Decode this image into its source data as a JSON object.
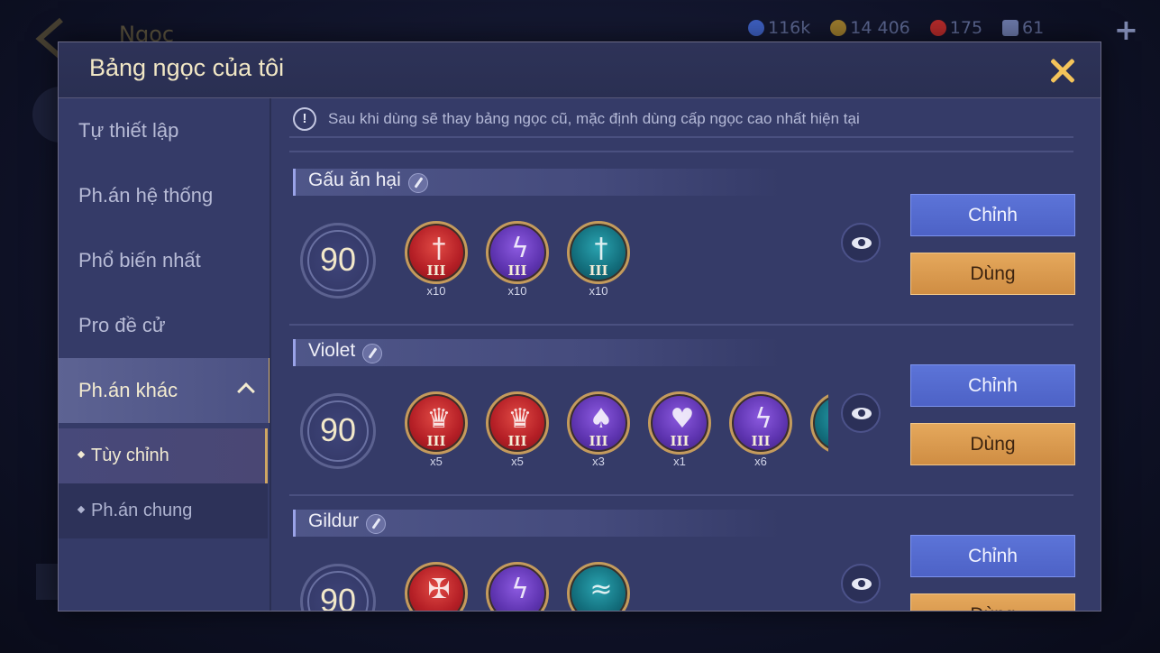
{
  "background": {
    "title": "Ngọc",
    "currencies": [
      {
        "icon": "diamond-coin-icon",
        "value": "116k",
        "color": "#3d5fc0"
      },
      {
        "icon": "gold-coin-icon",
        "value": "14 406",
        "color": "#9a7a2d"
      },
      {
        "icon": "ruby-icon",
        "value": "175",
        "color": "#b32a2a"
      },
      {
        "icon": "voucher-icon",
        "value": "61",
        "color": "#6b78a8"
      }
    ]
  },
  "modal": {
    "title": "Bảng ngọc của tôi",
    "notice": "Sau khi dùng sẽ thay bảng ngọc cũ, mặc định dùng cấp ngọc cao nhất hiện tại"
  },
  "sidebar": {
    "items": [
      {
        "label": "Tự thiết lập"
      },
      {
        "label": "Ph.án hệ thống"
      },
      {
        "label": "Phổ biến nhất"
      },
      {
        "label": "Pro đề cử"
      },
      {
        "label": "Ph.án khác"
      }
    ],
    "subitems": [
      {
        "label": "Tùy chỉnh"
      },
      {
        "label": "Ph.án chung"
      }
    ]
  },
  "sets": [
    {
      "name": "Gấu ăn hại",
      "level": "90",
      "arcanas": [
        {
          "color": "red",
          "icon": "sword-icon",
          "tier": "III",
          "count": "x10"
        },
        {
          "color": "purple",
          "icon": "lightning-icon",
          "tier": "III",
          "count": "x10"
        },
        {
          "color": "teal",
          "icon": "sword-icon",
          "tier": "III",
          "count": "x10"
        }
      ],
      "edit_label": "Chỉnh",
      "use_label": "Dùng"
    },
    {
      "name": "Violet",
      "level": "90",
      "arcanas": [
        {
          "color": "red",
          "icon": "crown-icon",
          "tier": "III",
          "count": "x5"
        },
        {
          "color": "red",
          "icon": "crown-icon",
          "tier": "III",
          "count": "x5"
        },
        {
          "color": "purple",
          "icon": "drop-icon",
          "tier": "III",
          "count": "x3"
        },
        {
          "color": "purple",
          "icon": "heart-icon",
          "tier": "III",
          "count": "x1"
        },
        {
          "color": "purple",
          "icon": "lightning-icon",
          "tier": "III",
          "count": "x6"
        },
        {
          "color": "teal",
          "icon": "sword-icon",
          "tier": "",
          "count": ""
        }
      ],
      "edit_label": "Chỉnh",
      "use_label": "Dùng"
    },
    {
      "name": "Gildur",
      "level": "90",
      "arcanas": [
        {
          "color": "red",
          "icon": "claw-icon",
          "tier": "",
          "count": ""
        },
        {
          "color": "purple",
          "icon": "lightning-icon",
          "tier": "",
          "count": ""
        },
        {
          "color": "teal",
          "icon": "wave-icon",
          "tier": "",
          "count": ""
        }
      ],
      "edit_label": "Chỉnh",
      "use_label": "Dùng"
    }
  ],
  "colors": {
    "accent_gold": "#f4c45a",
    "edit_button": "#5c74d8",
    "use_button": "#e5a85c"
  }
}
